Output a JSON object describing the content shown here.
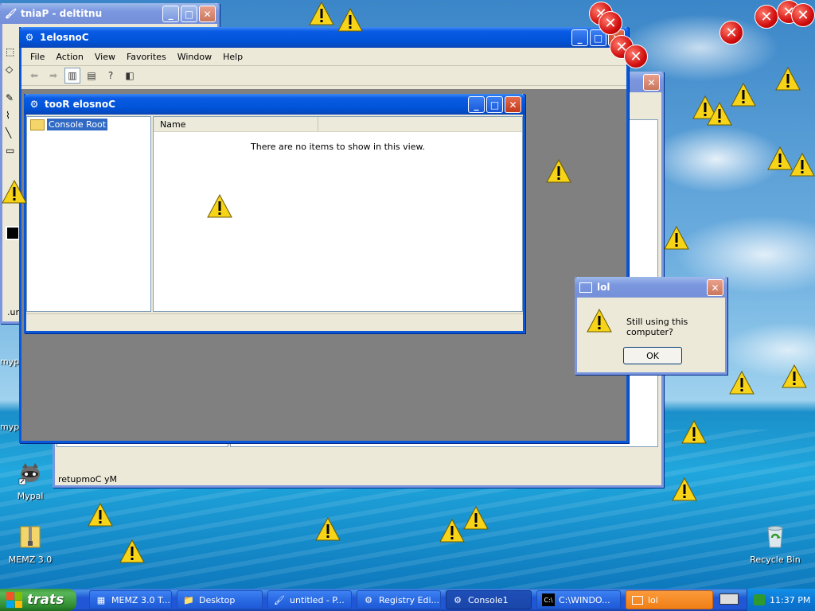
{
  "windows": {
    "paint": {
      "title": "tniaP - deltitnu",
      "status_fragment": ".un"
    },
    "background_explorer": {
      "status": "retupmoC yM"
    },
    "console1": {
      "title": "1elosnoC",
      "menu": [
        "File",
        "Action",
        "View",
        "Favorites",
        "Window",
        "Help"
      ]
    },
    "console_root": {
      "title": "tooR elosnoC",
      "tree_item": "Console Root",
      "column_header": "Name",
      "empty_message": "There are no items to show in this view."
    },
    "lol_dialog": {
      "title": "lol",
      "message": "Still using this computer?",
      "ok_label": "OK"
    }
  },
  "desktop_icons": [
    {
      "label": "myp"
    },
    {
      "label": "myp"
    },
    {
      "label": "Mypal"
    },
    {
      "label": "MEMZ 3.0"
    },
    {
      "label": "Recycle Bin"
    }
  ],
  "taskbar": {
    "start_label": "trats",
    "tasks": [
      {
        "label": "MEMZ 3.0 T...",
        "icon": "memz-icon"
      },
      {
        "label": "Desktop",
        "icon": "folder-icon"
      },
      {
        "label": "untitled - P...",
        "icon": "paint-icon"
      },
      {
        "label": "Registry Edi...",
        "icon": "regedit-icon"
      },
      {
        "label": "Console1",
        "icon": "mmc-icon"
      },
      {
        "label": "C:\\WINDO...",
        "icon": "cmd-icon"
      },
      {
        "label": "lol",
        "icon": "window-icon"
      }
    ],
    "clock": "11:37 PM"
  },
  "colors": {
    "title_active": "#0a5ce6",
    "warning": "#f7d417",
    "error": "#d20f0f",
    "taskbar": "#2157d7",
    "start": "#3c9a3c"
  }
}
